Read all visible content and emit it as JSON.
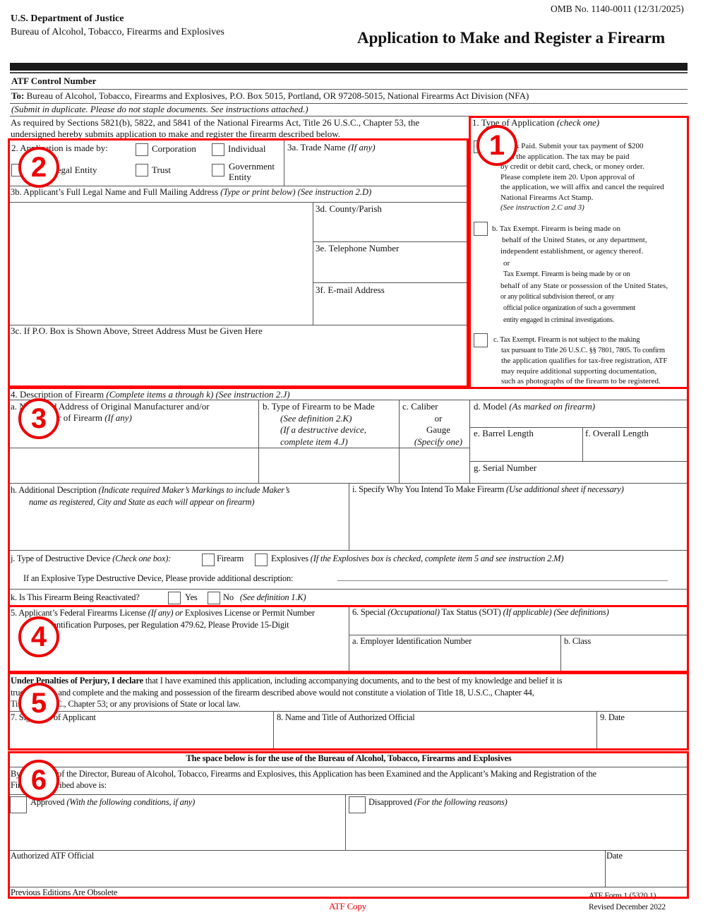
{
  "header": {
    "department": "U.S. Department  of Justice",
    "bureau": "Bureau of Alcohol, Tobacco, Firearms and Explosives",
    "omb": "OMB No. 1140-0011 (12/31/2025)",
    "title": "Application to Make and Register a Firearm",
    "control_number_label": "ATF Control Number",
    "to_label": "To:",
    "to_text": "Bureau of Alcohol, Tobacco, Firearms and Explosives, P.O. Box 5015, Portland, OR 97208-5015, National Firearms Act Division (NFA)",
    "submit_note": "(Submit in duplicate.  Please do not staple documents.  See instructions attached.)",
    "required_line1": "As required by Sections 5821(b), 5822, and 5841 of the National Firearms Act, Title 26 U.S.C., Chapter 53, the",
    "required_line2": "undersigned hereby submits application to make and register the firearm described below."
  },
  "item1": {
    "label": "1.    Type of Application",
    "label_note": "(check one)",
    "a_lines": [
      "a.  Tax Paid.  Submit your tax payment of $200",
      "with the application.  The tax may be paid",
      "by credit or debit card, check, or money order.",
      "Please complete item 20.  Upon approval of",
      "the application, we will affix and cancel the required",
      "National Firearms Act Stamp."
    ],
    "a_note": "(See instruction 2.C and 3)",
    "b_lines": [
      "b.   Tax Exempt.  Firearm is being made on",
      "behalf of the United States, or any department,",
      "independent establishment, or agency thereof.",
      "or",
      "Tax Exempt.  Firearm is being made  by or on",
      "behalf of any State or possession of the United States,",
      "or any political subdivision thereof, or any",
      "official police organization of such a government",
      "entity engaged in criminal investigations."
    ],
    "c_lines": [
      "c.  Tax Exempt.  Firearm is not subject to the  making",
      "tax pursuant to Title 26 U.S.C. §§ 7801, 7805.  To confirm",
      "the application qualifies for tax-free registration, ATF",
      "may require additional supporting documentation,",
      "such as photographs of the firearm to be registered."
    ]
  },
  "item2": {
    "label": "2.    Application is made by:",
    "options": [
      "Corporation",
      "Individual",
      "Other Legal Entity",
      "Trust",
      "Government",
      "Entity"
    ]
  },
  "item3": {
    "a_label": "3a.  Trade Name",
    "a_note": "(If any)",
    "b_label": "3b.  Applicant’s Full Legal Name and Full Mailing Address",
    "b_note": "(Type or print below) (See instruction 2.D)",
    "d_label": "3d.  County/Parish",
    "e_label": "3e.  Telephone Number",
    "f_label": "3f.  E-mail Address",
    "c_label": "3c.  If P.O. Box is Shown Above, Street Address Must be Given Here"
  },
  "item4": {
    "label": "4.    Description of Firearm",
    "label_note": "(Complete items a through k) (See instruction 2.J)",
    "a_label1": "a.    Name and Address of Original Manufacturer and/or",
    "a_label2": "Importer of Firearm",
    "a_note": "(If any)",
    "b_label": "b.    Type of Firearm to be Made",
    "b_note1": "(See definition 2.K)",
    "b_note2": "(If a destructive device,",
    "b_note3": "complete item 4.J)",
    "c_label": "c.    Caliber",
    "c_or": "or",
    "c_gauge": "Gauge",
    "c_note": "(Specify one)",
    "d_label": "d.   Model",
    "d_note": "(As marked on firearm)",
    "e_label": "e.   Barrel Length",
    "f_label": "f.     Overall Length",
    "g_label": "g.   Serial Number",
    "h_label": "h.    Additional Description",
    "h_note1": "(Indicate required Maker’s Markings to include Maker’s",
    "h_note2": "name as registered, City and State as each will appear on firearm)",
    "i_label": "i.     Specify Why You Intend To Make Firearm",
    "i_note": "(Use additional sheet if necessary)",
    "j_label": "j.  Type of Destructive Device",
    "j_note": "(Check one box):",
    "j_opt1": "Firearm",
    "j_opt2": "Explosives",
    "j_opt2_note": "(If the Explosives box is checked, complete item 5 and see instruction 2.M)",
    "j_explosive_desc": "If an Explosive Type Destructive Device, Please provide additional description:",
    "k_label": "k.  Is This Firearm Being Reactivated?",
    "k_yes": "Yes",
    "k_no": "No",
    "k_note": "(See definition 1.K)"
  },
  "item5": {
    "label1_a": "5.    Applicant’s Federal Firearms License",
    "label1_note": "(If any) or",
    "label1_b": "Explosives License or Permit Number",
    "label2": "(For Identification Purposes, per Regulation 479.62, Please Provide 15-Digit"
  },
  "item6": {
    "label": "6.    Special",
    "label_note1": "(Occupational)",
    "label_mid": "Tax Status (SOT)",
    "label_note2": "(If applicable) (See definitions)",
    "a_label": "a.    Employer Identification Number",
    "b_label": "b.    Class"
  },
  "perjury": {
    "bold": "Under Penalties of Perjury, I declare",
    "line1": "that I have examined this application, including accompanying documents, and to the best of my knowledge and belief it is",
    "line2": "true, accurate and complete and the making and possession of the firearm described above would not constitute a violation of Title 18, U.S.C., Chapter 44,",
    "line3": "Title 26, U.S.C., Chapter 53; or any provisions of State or local law.",
    "item7": "7.    Signature of Applicant",
    "item8": "8.    Name and Title of Authorized Official",
    "item9": "9.    Date"
  },
  "atf_use": {
    "header": "The space below is for the use of the Bureau of Alcohol, Tobacco, Firearms and Explosives",
    "line1": "By Authority of the Director, Bureau of Alcohol, Tobacco, Firearms and Explosives, this Application has been Examined and the Applicant’s Making and Registration of the",
    "line2": "Firearm Described above is:",
    "approved": "Approved",
    "approved_note": "(With the following conditions, if any)",
    "disapproved": "Disapproved",
    "disapproved_note": "(For the following reasons)",
    "official": "Authorized ATF Official",
    "date": "Date"
  },
  "footer": {
    "obsolete": "Previous Editions Are Obsolete",
    "copy": "ATF Copy",
    "form": "ATF Form 1 (5320.1)",
    "revised": "Revised December 2022"
  },
  "annotations": {
    "badges": [
      "1",
      "2",
      "3",
      "4",
      "5",
      "6"
    ],
    "color": "#ff0000"
  }
}
